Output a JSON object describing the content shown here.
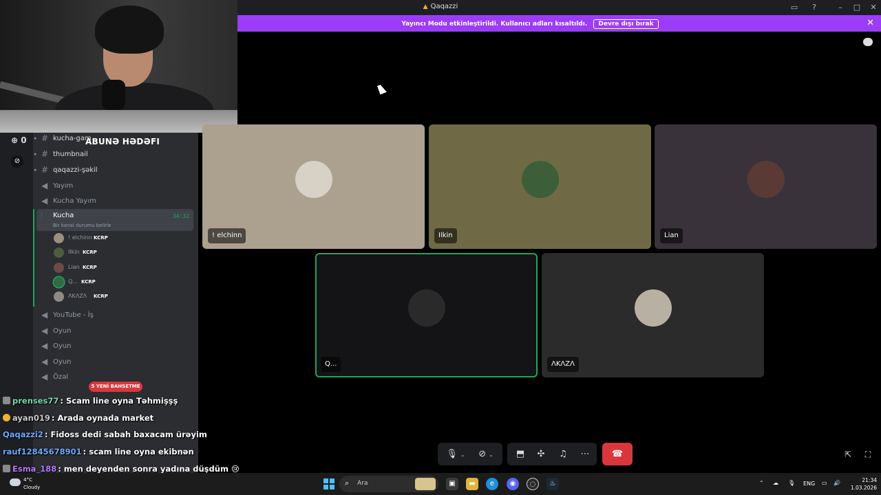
{
  "window": {
    "title": "Qaqazzi"
  },
  "banner": {
    "text": "Yayıncı Modu etkinleştirildi. Kullanıcı adları kısaltıldı.",
    "button_label": "Devre dışı bırak",
    "close_symbol": "✕"
  },
  "overlay": {
    "goal_label": "ABUNƏ HƏDƏFI",
    "goal_count": "0"
  },
  "sidebar": {
    "channels": [
      {
        "name": "kucha-gam",
        "type": "text"
      },
      {
        "name": "thumbnail",
        "type": "text"
      },
      {
        "name": "qaqazzi-şəkil",
        "type": "text"
      },
      {
        "name": "Yayım",
        "type": "voice"
      },
      {
        "name": "Kucha Yayım",
        "type": "voice"
      }
    ],
    "active_channel": {
      "name": "Kucha",
      "status": "Bir kanal durumu belirle",
      "time": "34:32"
    },
    "voice_users": [
      {
        "name": "! elchinn",
        "tag": "KCRP"
      },
      {
        "name": "Ilkin",
        "tag": "KCRP"
      },
      {
        "name": "Lian",
        "tag": "KCRP"
      },
      {
        "name": "Q...",
        "tag": "KCRP"
      },
      {
        "name": "ΛKΛZΛ",
        "tag": "KCRP"
      }
    ],
    "channels_after": [
      {
        "name": "YouTube - İş",
        "type": "voice"
      },
      {
        "name": "Oyun",
        "type": "voice"
      },
      {
        "name": "Oyun",
        "type": "voice"
      },
      {
        "name": "Oyun",
        "type": "voice"
      },
      {
        "name": "Özəl",
        "type": "voice"
      }
    ],
    "new_mentions": "5 YENİ BAHSETME"
  },
  "chat": [
    {
      "user": "prenses77",
      "message": ": Scam line oyna Təhmişşş",
      "color": "#7fd4a8",
      "badge": "grey"
    },
    {
      "user": "ayan019",
      "message": ": Arada oynada market",
      "color": "#c9c9c9",
      "badge": "gold"
    },
    {
      "user": "Qaqazzi2",
      "message": ": Fidoss dedi sabah baxacam ürəyim",
      "color": "#6fa8ff",
      "badge": "none"
    },
    {
      "user": "rauf12845678901",
      "message": ": scam line oyna ekibnən",
      "color": "#6fa8ff",
      "badge": "none"
    },
    {
      "user": "Esma_188",
      "message": ": men deyenden sonra yadına düşdüm 😢",
      "color": "#b57bff",
      "badge": "grey"
    }
  ],
  "stage": {
    "count": "2",
    "tiles": [
      {
        "name": "! elchinn",
        "bg": "#aca08f",
        "avatar": "#d8d2c6"
      },
      {
        "name": "Ilkin",
        "bg": "#6f6a45",
        "avatar": "#3c5f3a"
      },
      {
        "name": "Lian",
        "bg": "#39323a",
        "avatar": "#5a3a35"
      },
      {
        "name": "Q...",
        "bg": "#141416",
        "avatar": "#2a2a2a",
        "speaking": true
      },
      {
        "name": "ΛKΛZΛ",
        "bg": "#2b2b2b",
        "avatar": "#b9b0a4"
      }
    ]
  },
  "controls": {
    "mic_icon": "🎙",
    "camera_icon": "⊘",
    "screen_icon": "⬒",
    "activity_icon": "✣",
    "soundboard_icon": "♫",
    "more_icon": "⋯",
    "hangup_icon": "☎",
    "popout_icon": "⇱",
    "fullscreen_icon": "⛶"
  },
  "taskbar": {
    "temperature": "4°C",
    "condition": "Cloudy",
    "search_placeholder": "Ara",
    "language": "ENG",
    "time": "21:34",
    "date": "1.03.2026"
  },
  "colors": {
    "accent": "#9b3df6",
    "speaking": "#23a55a",
    "danger": "#da373c"
  }
}
